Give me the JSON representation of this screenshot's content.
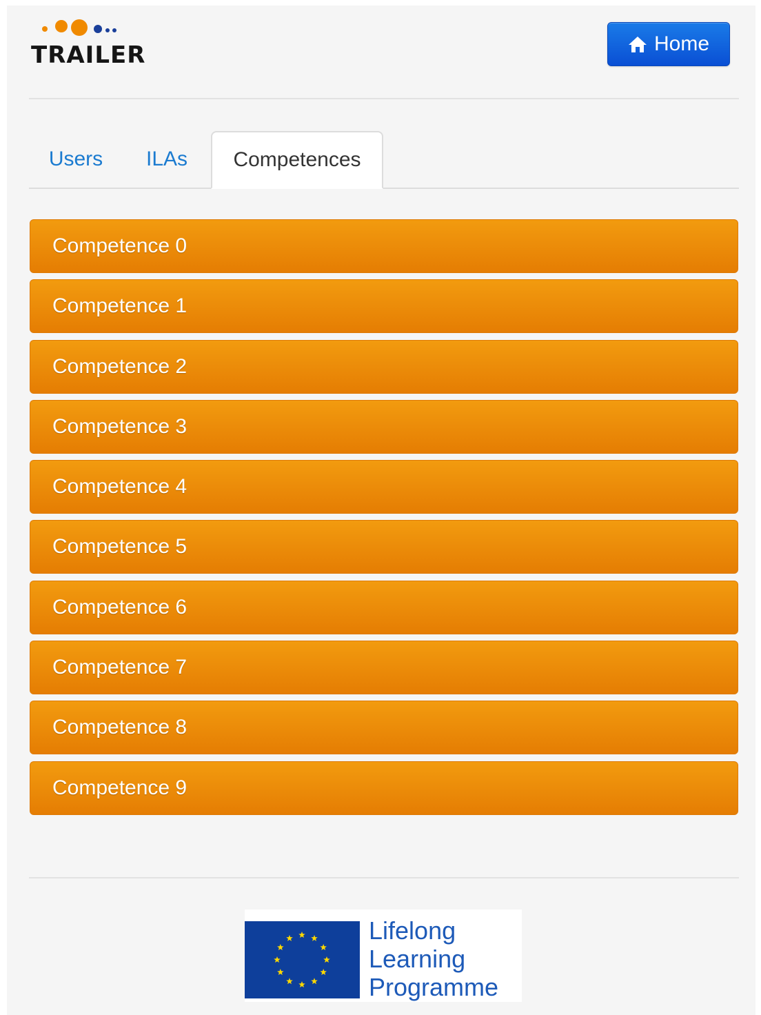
{
  "header": {
    "logo_text": "TRAILER",
    "home_label": "Home",
    "home_icon": "home-icon"
  },
  "tabs": [
    {
      "label": "Users",
      "active": false
    },
    {
      "label": "ILAs",
      "active": false
    },
    {
      "label": "Competences",
      "active": true
    }
  ],
  "competences": [
    "Competence 0",
    "Competence 1",
    "Competence 2",
    "Competence 3",
    "Competence 4",
    "Competence 5",
    "Competence 6",
    "Competence 7",
    "Competence 8",
    "Competence 9"
  ],
  "footer": {
    "programme_lines": [
      "Lifelong",
      "Learning",
      "Programme"
    ]
  },
  "colors": {
    "accent_orange": "#ed8a08",
    "button_blue": "#0a5ad8",
    "link_blue": "#1b7bd0",
    "eu_blue": "#0e3f9b",
    "eu_star_yellow": "#ffd800"
  }
}
